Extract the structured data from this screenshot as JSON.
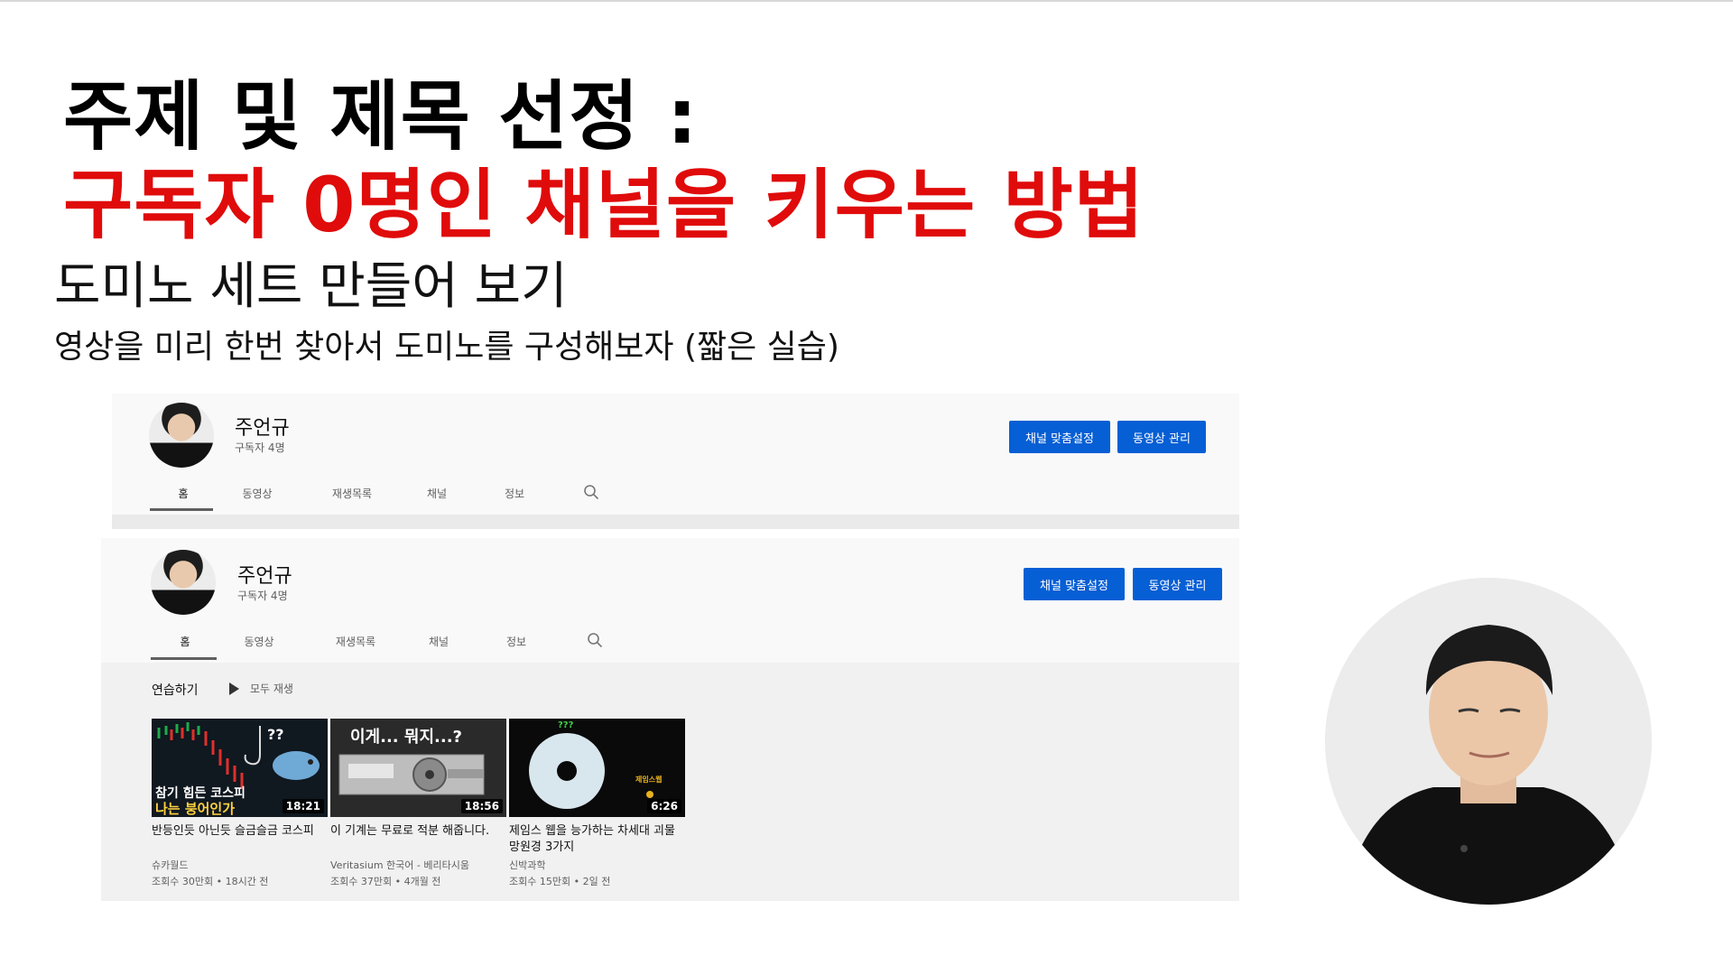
{
  "slide": {
    "title_line1": "주제 및 제목 선정 :",
    "title_line2": "구독자 0명인 채널을 키우는 방법",
    "subtitle": "도미노 세트 만들어 보기",
    "description": "영상을 미리 한번 찾아서 도미노를 구성해보자 (짧은 실습)"
  },
  "screenshot_top": {
    "channel_name": "주언규",
    "subscribers": "구독자 4명",
    "buttons": [
      "채널 맞춤설정",
      "동영상 관리"
    ],
    "tabs": [
      "홈",
      "동영상",
      "재생목록",
      "채널",
      "정보"
    ],
    "active_tab": "홈"
  },
  "screenshot_bottom": {
    "channel_name": "주언규",
    "subscribers": "구독자 4명",
    "buttons": [
      "채널 맞춤설정",
      "동영상 관리"
    ],
    "tabs": [
      "홈",
      "동영상",
      "재생목록",
      "채널",
      "정보"
    ],
    "active_tab": "홈",
    "section_title": "연습하기",
    "play_all": "모두 재생",
    "videos": [
      {
        "thumb_text": [
          "참기 힘든 코스피",
          "나는 붕어인가"
        ],
        "thumb_marks": "??",
        "duration": "18:21",
        "title": "반등인듯 아닌듯 슬금슬금 코스피",
        "channel": "슈카월드",
        "meta": "조회수 30만회 • 18시간 전"
      },
      {
        "thumb_text": [
          "이게... 뭐지...?"
        ],
        "duration": "18:56",
        "title": "이 기계는 무료로 적분 해줍니다.",
        "channel": "Veritasium 한국어 - 베리타시움",
        "meta": "조회수 37만회 • 4개월 전"
      },
      {
        "thumb_text": [
          "???",
          "제임스웹"
        ],
        "duration": "6:26",
        "title": "제임스 웹을 능가하는 차세대 괴물 망원경 3가지",
        "channel": "신박과학",
        "meta": "조회수 15만회 • 2일 전"
      }
    ]
  },
  "colors": {
    "accent_red": "#e00b0b",
    "youtube_blue": "#065fd4",
    "text_dark": "#111111",
    "text_gray": "#606060"
  },
  "icons": [
    "search-icon",
    "play-icon"
  ]
}
